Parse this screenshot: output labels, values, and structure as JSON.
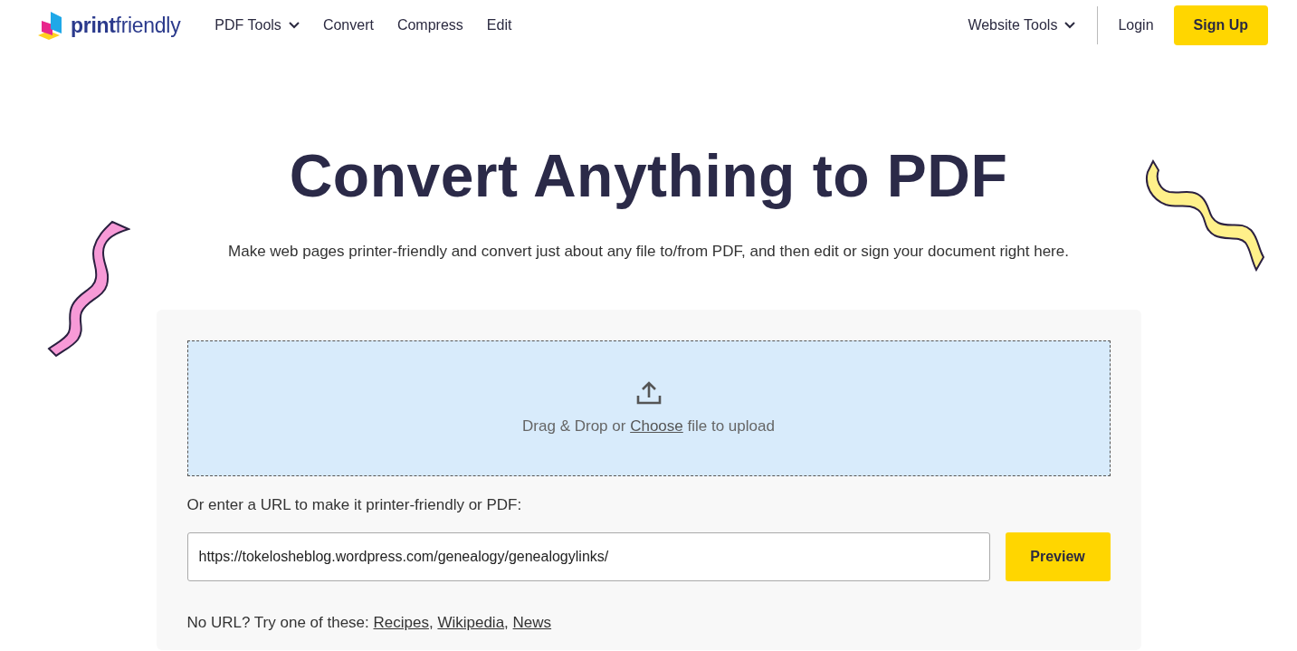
{
  "logo": {
    "text": "**print**friendly"
  },
  "nav": [
    {
      "label": "PDF Tools",
      "kind": "dropdown"
    },
    {
      "label": "Convert",
      "kind": "link"
    },
    {
      "label": "Compress",
      "kind": "link"
    },
    {
      "label": "Edit",
      "kind": "link"
    }
  ],
  "nav_right": [
    {
      "label": "Website Tools",
      "kind": "dropdown"
    },
    {
      "label": "Login",
      "kind": "link"
    },
    {
      "label": "Sign Up",
      "kind": "button"
    }
  ],
  "hero": {
    "title": "Convert Anything to PDF",
    "subtitle": "Make web pages printer-friendly and convert just about any file to/from PDF, and then edit or sign your document right here."
  },
  "upload": {
    "before": "Drag & Drop or",
    "link": "Choose",
    "after": "file to upload"
  },
  "url_form": {
    "label": "Or enter a URL to make it printer-friendly or PDF:",
    "value": "https://tokelosheblog.wordpress.com/genealogy/genealogylinks/",
    "button": "Preview"
  },
  "suggestions": {
    "label": "No URL? Try one of these:",
    "links": [
      "Recipes",
      "Wikipedia",
      "News"
    ],
    "separator": ","
  }
}
